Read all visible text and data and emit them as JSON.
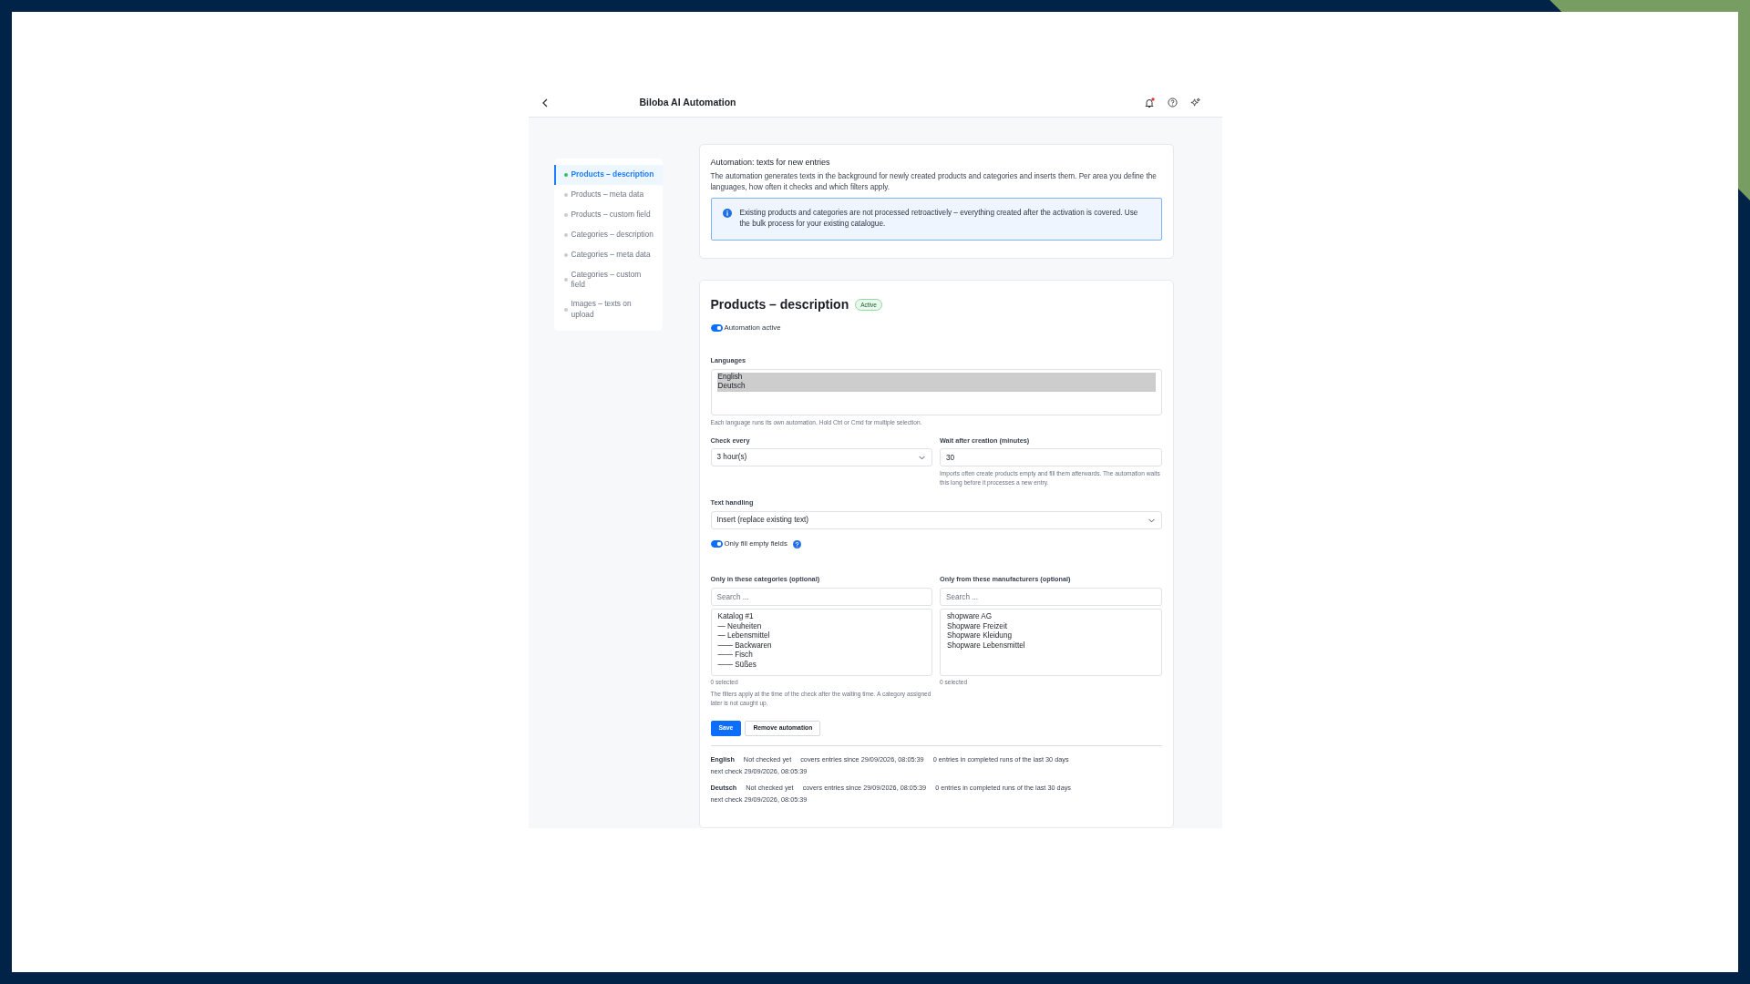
{
  "header": {
    "title": "Biloba AI Automation",
    "unread_notifications": true
  },
  "sidebar": {
    "items": [
      {
        "label": "Products – description",
        "selected": true,
        "active": true
      },
      {
        "label": "Products – meta data",
        "selected": false,
        "active": false
      },
      {
        "label": "Products – custom field",
        "selected": false,
        "active": false
      },
      {
        "label": "Categories – description",
        "selected": false,
        "active": false
      },
      {
        "label": "Categories – meta data",
        "selected": false,
        "active": false
      },
      {
        "label": "Categories – custom field",
        "selected": false,
        "active": false
      },
      {
        "label": "Images – texts on upload",
        "selected": false,
        "active": false
      }
    ]
  },
  "intro": {
    "title": "Automation: texts for new entries",
    "text": "The automation generates texts in the background for newly created products and categories and inserts them. Per area you define the languages, how often it checks and which filters apply.",
    "notice": "Existing products and categories are not processed retroactively – everything created after the activation is covered. Use the bulk process for your existing catalogue."
  },
  "section": {
    "title": "Products – description",
    "badge": "Active",
    "automation_active": {
      "label": "Automation active",
      "on": true
    },
    "languages": {
      "label": "Languages",
      "options": [
        {
          "label": "English",
          "selected": true
        },
        {
          "label": "Deutsch",
          "selected": true
        }
      ],
      "help": "Each language runs its own automation. Hold Ctrl or Cmd for multiple selection."
    },
    "check_every": {
      "label": "Check every",
      "value": "3 hour(s)"
    },
    "wait_after_creation": {
      "label": "Wait after creation (minutes)",
      "value": "30",
      "help": "Imports often create products empty and fill them afterwards. The automation waits this long before it processes a new entry."
    },
    "text_handling": {
      "label": "Text handling",
      "value": "Insert (replace existing text)"
    },
    "only_empty": {
      "label": "Only fill empty fields",
      "on": true
    },
    "categories": {
      "label": "Only in these categories (optional)",
      "placeholder": "Search ...",
      "options": [
        {
          "label": "Katalog #1",
          "selected": false
        },
        {
          "label": "— Neuheiten",
          "selected": false
        },
        {
          "label": "— Lebensmittel",
          "selected": false
        },
        {
          "label": "—— Backwaren",
          "selected": false
        },
        {
          "label": "—— Fisch",
          "selected": false
        },
        {
          "label": "—— Süßes",
          "selected": false
        }
      ],
      "count": "0 selected",
      "help": "The filters apply at the time of the check after the waiting time. A category assigned later is not caught up."
    },
    "manufacturers": {
      "label": "Only from these manufacturers (optional)",
      "placeholder": "Search ...",
      "options": [
        {
          "label": "shopware AG",
          "selected": false
        },
        {
          "label": "Shopware Freizeit",
          "selected": false
        },
        {
          "label": "Shopware Kleidung",
          "selected": false
        },
        {
          "label": "Shopware Lebensmittel",
          "selected": false
        }
      ],
      "count": "0 selected"
    },
    "buttons": [
      {
        "label": "Save",
        "kind": "primary"
      },
      {
        "label": "Remove automation",
        "kind": "secondary"
      }
    ],
    "status": [
      {
        "language": "English",
        "state": "Not checked yet",
        "covers": "covers entries since 29/09/2026, 08:05:39",
        "entries": "0 entries in completed runs of the last 30 days",
        "next_check": "next check 29/09/2026, 08:05:39"
      },
      {
        "language": "Deutsch",
        "state": "Not checked yet",
        "covers": "covers entries since 29/09/2026, 08:05:39",
        "entries": "0 entries in completed runs of the last 30 days",
        "next_check": "next check 29/09/2026, 08:05:39"
      }
    ]
  }
}
